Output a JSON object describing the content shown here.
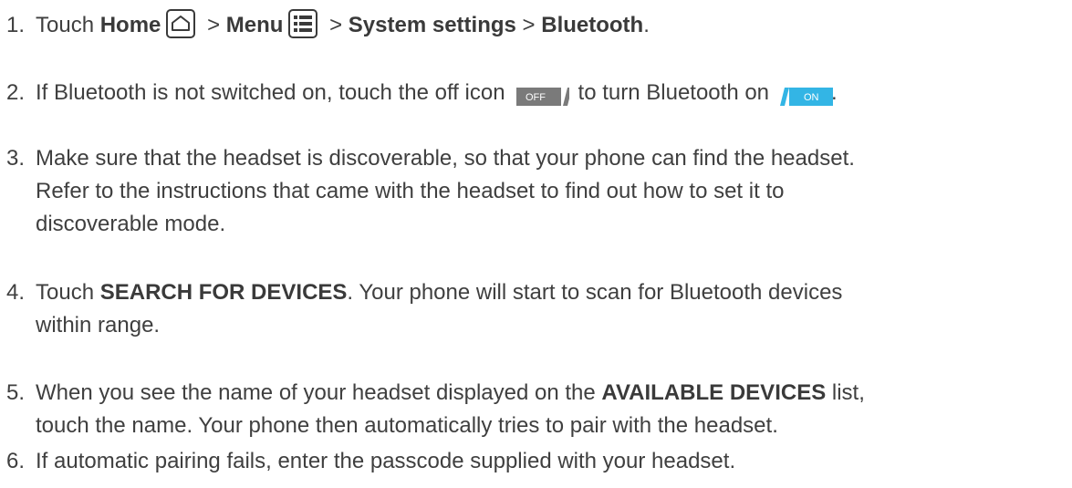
{
  "steps": [
    {
      "number": "1.",
      "prefix": "Touch ",
      "home": "Home",
      "sep1": " > ",
      "menu": "Menu",
      "sep2": " > ",
      "system_settings": "System settings",
      "sep3": " > ",
      "bluetooth": "Bluetooth",
      "end": "."
    },
    {
      "number": "2.",
      "text1": "If Bluetooth is not switched on, touch the off icon",
      "off_label": "OFF",
      "text2": "to turn Bluetooth on",
      "on_label": "ON",
      "end": "."
    },
    {
      "number": "3.",
      "line1": "Make sure that the headset is discoverable, so that your phone can find the headset.",
      "line2": "Refer to the instructions that came with the headset to find out how to set it to",
      "line3": "discoverable mode."
    },
    {
      "number": "4.",
      "prefix": "Touch ",
      "bold": "SEARCH FOR DEVICES",
      "suffix": ". Your phone will start to scan for Bluetooth devices",
      "line2": "within range."
    },
    {
      "number": "5.",
      "prefix": "When you see the name of your headset displayed on the ",
      "bold": "AVAILABLE DEVICES",
      "suffix": " list,",
      "line2": "touch the name. Your phone then automatically tries to pair with the headset."
    },
    {
      "number": "6.",
      "text": "If automatic pairing fails, enter the passcode supplied with your headset."
    }
  ],
  "colors": {
    "text": "#3f3f3f",
    "toggle_off": "#7a7a7a",
    "toggle_on": "#33b5e5"
  },
  "icons": [
    "home-icon",
    "menu-icon",
    "toggle-off-icon",
    "toggle-on-icon"
  ]
}
